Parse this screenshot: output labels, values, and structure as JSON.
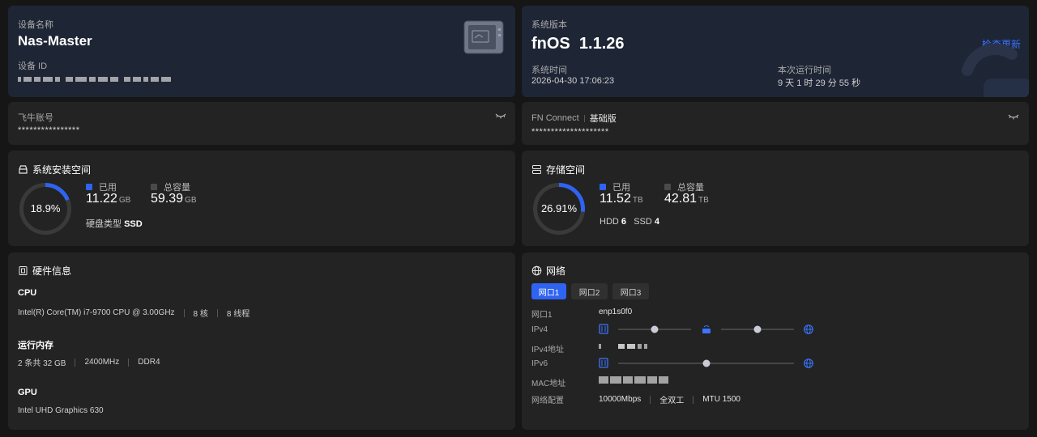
{
  "device": {
    "name_label": "设备名称",
    "name": "Nas-Master",
    "id_label": "设备 ID"
  },
  "system": {
    "version_label": "系统版本",
    "version": "fnOS  1.1.26",
    "check_update": "检查更新",
    "time_label": "系统时间",
    "time": "2026-04-30 17:06:23",
    "uptime_label": "本次运行时间",
    "uptime": "9 天 1 时 29 分 55 秒"
  },
  "account": {
    "label": "飞牛账号",
    "masked": "****************"
  },
  "connect": {
    "label": "FN Connect",
    "tier": "基础版",
    "masked": "********************"
  },
  "install_space": {
    "title": "系统安装空间",
    "percent_text": "18.9%",
    "percent": 18.9,
    "used_label": "已用",
    "used": "11.22",
    "used_unit": "GB",
    "total_label": "总容量",
    "total": "59.39",
    "total_unit": "GB",
    "disk_type_label": "硬盘类型",
    "disk_type": "SSD"
  },
  "storage": {
    "title": "存储空间",
    "percent_text": "26.91%",
    "percent": 26.91,
    "used_label": "已用",
    "used": "11.52",
    "used_unit": "TB",
    "total_label": "总容量",
    "total": "42.81",
    "total_unit": "TB",
    "hdd_label": "HDD",
    "hdd": "6",
    "ssd_label": "SSD",
    "ssd": "4"
  },
  "hardware": {
    "title": "硬件信息",
    "cpu_label": "CPU",
    "cpu_model": "Intel(R) Core(TM) i7-9700 CPU @ 3.00GHz",
    "cpu_cores": "8 核",
    "cpu_threads": "8 线程",
    "mem_label": "运行内存",
    "mem_size": "2 条共 32 GB",
    "mem_speed": "2400MHz",
    "mem_type": "DDR4",
    "gpu_label": "GPU",
    "gpu_model": "Intel UHD Graphics 630"
  },
  "network": {
    "title": "网络",
    "tabs": [
      "网口1",
      "网口2",
      "网口3"
    ],
    "port_label": "网口1",
    "port_value": "enp1s0f0",
    "ipv4_label": "IPv4",
    "ipv4_addr_label": "IPv4地址",
    "ipv6_label": "IPv6",
    "mac_label": "MAC地址",
    "config_label": "网络配置",
    "speed": "10000Mbps",
    "duplex": "全双工",
    "mtu": "MTU 1500"
  },
  "colors": {
    "accent": "#2f63f2",
    "ring_track": "#3a3a3a",
    "card": "#232323",
    "card_blue": "#1e2535"
  }
}
